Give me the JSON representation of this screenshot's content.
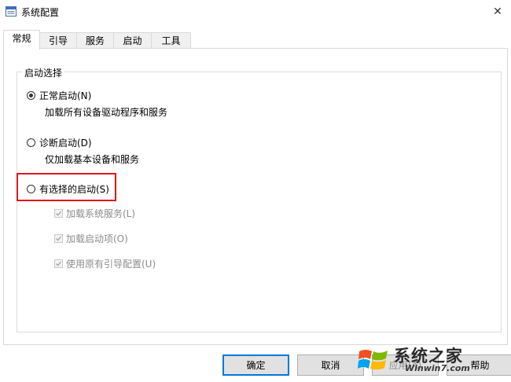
{
  "window": {
    "title": "系统配置",
    "close_glyph": "✕"
  },
  "tabs": [
    {
      "label": "常规",
      "active": true
    },
    {
      "label": "引导",
      "active": false
    },
    {
      "label": "服务",
      "active": false
    },
    {
      "label": "启动",
      "active": false
    },
    {
      "label": "工具",
      "active": false
    }
  ],
  "startup_group": {
    "legend": "启动选择",
    "options": [
      {
        "label": "正常启动(N)",
        "description": "加载所有设备驱动程序和服务",
        "selected": true
      },
      {
        "label": "诊断启动(D)",
        "description": "仅加载基本设备和服务",
        "selected": false
      },
      {
        "label": "有选择的启动(S)",
        "description": "",
        "selected": false,
        "highlighted": true
      }
    ],
    "selective_items": [
      {
        "label": "加载系统服务(L)",
        "checked": true,
        "enabled": false
      },
      {
        "label": "加载启动项(O)",
        "checked": true,
        "enabled": false
      },
      {
        "label": "使用原有引导配置(U)",
        "checked": true,
        "enabled": false
      }
    ]
  },
  "buttons": {
    "ok": "确定",
    "cancel": "取消",
    "apply": "应用(A)",
    "help": "帮助"
  },
  "watermark": {
    "title": "系统之家",
    "url": "Winwin7.com"
  },
  "colors": {
    "highlight": "#e0161b",
    "default_button_border": "#0078d7"
  },
  "icons": {
    "app": "msconfig-icon",
    "close": "close-icon",
    "watermark": "windows7-logo-icon"
  }
}
